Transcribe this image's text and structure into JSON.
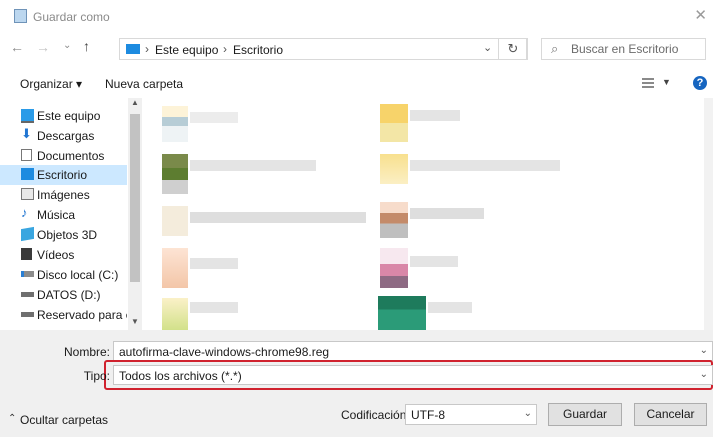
{
  "window": {
    "title": "Guardar como"
  },
  "nav": {
    "back_icon": "arrow-left",
    "forward_icon": "arrow-right",
    "up_icon": "arrow-up",
    "breadcrumb": [
      "Este equipo",
      "Escritorio"
    ],
    "search_placeholder": "Buscar en Escritorio"
  },
  "toolbar": {
    "organize": "Organizar ▾",
    "new_folder": "Nueva carpeta",
    "help": "?"
  },
  "sidebar": {
    "items": [
      {
        "label": "Este equipo",
        "icon": "computer-icon"
      },
      {
        "label": "Descargas",
        "icon": "download-icon"
      },
      {
        "label": "Documentos",
        "icon": "document-icon"
      },
      {
        "label": "Escritorio",
        "icon": "desktop-icon",
        "selected": true
      },
      {
        "label": "Imágenes",
        "icon": "image-icon"
      },
      {
        "label": "Música",
        "icon": "music-icon"
      },
      {
        "label": "Objetos 3D",
        "icon": "cube-icon"
      },
      {
        "label": "Vídeos",
        "icon": "video-icon"
      },
      {
        "label": "Disco local (C:)",
        "icon": "drive-icon"
      },
      {
        "label": "DATOS (D:)",
        "icon": "drive-icon"
      },
      {
        "label": "Reservado para e",
        "icon": "drive-icon"
      }
    ]
  },
  "form": {
    "name_label": "Nombre:",
    "name_value": "autofirma-clave-windows-chrome98.reg",
    "type_label": "Tipo:",
    "type_value": "Todos los archivos  (*.*)",
    "encoding_label": "Codificación:",
    "encoding_value": "UTF-8"
  },
  "footer": {
    "hide_folders": "Ocultar carpetas",
    "save": "Guardar",
    "cancel": "Cancelar"
  },
  "colors": {
    "accent": "#1665c0",
    "highlight_border": "#d0222e",
    "selected_bg": "#cce8ff"
  }
}
